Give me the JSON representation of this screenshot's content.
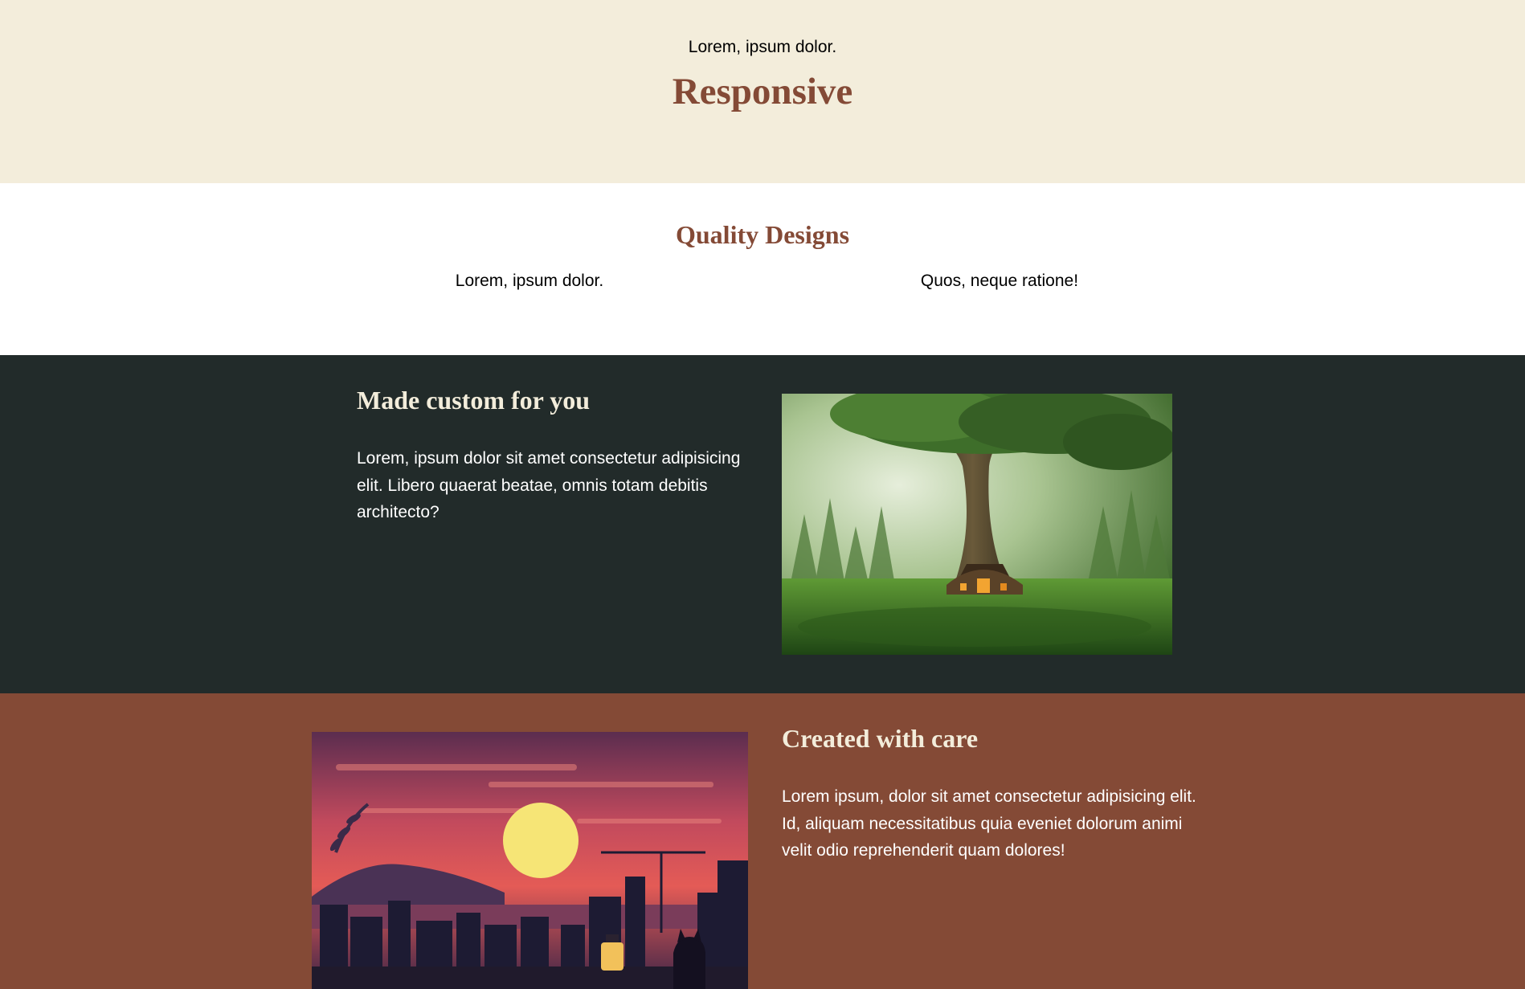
{
  "hero": {
    "eyebrow": "Lorem, ipsum dolor.",
    "title": "Responsive"
  },
  "quality": {
    "heading": "Quality Designs",
    "columns": [
      "Lorem, ipsum dolor.",
      "Quos, neque ratione!"
    ]
  },
  "features": [
    {
      "heading": "Made custom for you",
      "body": "Lorem, ipsum dolor sit amet consectetur adipisicing elit. Libero quaerat beatae, omnis totam debitis architecto?",
      "image": "fantasy-tree-house-image"
    },
    {
      "heading": "Created with care",
      "body": "Lorem ipsum, dolor sit amet consectetur adipisicing elit. Id, aliquam necessitatibus quia eveniet dolorum animi velit odio reprehenderit quam dolores!",
      "image": "sunset-city-cat-image"
    }
  ],
  "colors": {
    "cream": "#f3eddb",
    "brown": "#844a36",
    "dark": "#222b2a",
    "white": "#ffffff"
  }
}
